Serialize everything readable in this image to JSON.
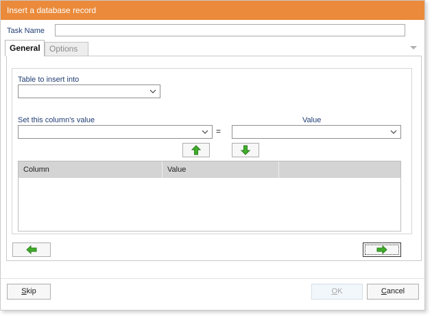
{
  "window": {
    "title": "Insert a database record"
  },
  "task": {
    "label": "Task Name",
    "value": ""
  },
  "tabs": [
    {
      "label": "General",
      "active": true
    },
    {
      "label": "Options",
      "active": false
    }
  ],
  "general": {
    "table_label": "Table to insert into",
    "table_value": "",
    "column_label": "Set this column's value",
    "column_value": "",
    "equals": "=",
    "value_label": "Value",
    "value_value": "",
    "move_up_icon": "green-up-arrow-icon",
    "move_down_icon": "green-down-arrow-icon",
    "grid": {
      "columns": [
        "Column",
        "Value"
      ],
      "rows": []
    },
    "remove_icon": "green-left-arrow-icon",
    "add_icon": "green-right-arrow-icon"
  },
  "footer": {
    "skip_label": "Skip",
    "skip_mnemonic": "S",
    "skip_rest": "kip",
    "ok_label": "OK",
    "ok_mnemonic": "O",
    "ok_rest": "K",
    "cancel_label": "Cancel",
    "cancel_mnemonic": "C",
    "cancel_rest": "ancel"
  },
  "colors": {
    "titlebar": "#ea8a3a",
    "label_text": "#1f3c73",
    "arrow_green": "#3fae2a"
  }
}
